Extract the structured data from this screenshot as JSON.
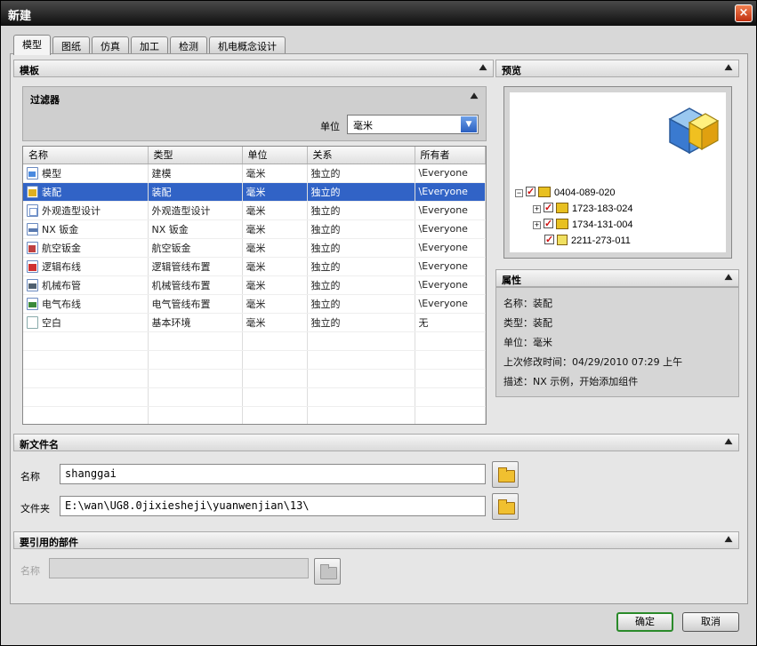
{
  "window": {
    "title": "新建",
    "close_label": "×"
  },
  "tabs": [
    {
      "label": "模型"
    },
    {
      "label": "图纸"
    },
    {
      "label": "仿真"
    },
    {
      "label": "加工"
    },
    {
      "label": "检测"
    },
    {
      "label": "机电概念设计"
    }
  ],
  "templates_section": {
    "title": "模板",
    "filter": {
      "title": "过滤器",
      "unit_label": "单位",
      "unit_value": "毫米"
    },
    "columns": [
      "名称",
      "类型",
      "单位",
      "关系",
      "所有者"
    ],
    "rows": [
      {
        "icon": "part-icon",
        "name": "模型",
        "type": "建模",
        "unit": "毫米",
        "relation": "独立的",
        "owner": "\\Everyone"
      },
      {
        "icon": "assembly-icon",
        "name": "装配",
        "type": "装配",
        "unit": "毫米",
        "relation": "独立的",
        "owner": "\\Everyone",
        "selected": true
      },
      {
        "icon": "shape-icon",
        "name": "外观造型设计",
        "type": "外观造型设计",
        "unit": "毫米",
        "relation": "独立的",
        "owner": "\\Everyone"
      },
      {
        "icon": "sheet-metal-icon",
        "name": "NX 钣金",
        "type": "NX 钣金",
        "unit": "毫米",
        "relation": "独立的",
        "owner": "\\Everyone"
      },
      {
        "icon": "aero-sheet-metal-icon",
        "name": "航空钣金",
        "type": "航空钣金",
        "unit": "毫米",
        "relation": "独立的",
        "owner": "\\Everyone"
      },
      {
        "icon": "logic-routing-icon",
        "name": "逻辑布线",
        "type": "逻辑管线布置",
        "unit": "毫米",
        "relation": "独立的",
        "owner": "\\Everyone"
      },
      {
        "icon": "mechanical-routing-icon",
        "name": "机械布管",
        "type": "机械管线布置",
        "unit": "毫米",
        "relation": "独立的",
        "owner": "\\Everyone"
      },
      {
        "icon": "electrical-routing-icon",
        "name": "电气布线",
        "type": "电气管线布置",
        "unit": "毫米",
        "relation": "独立的",
        "owner": "\\Everyone"
      },
      {
        "icon": "blank-icon",
        "name": "空白",
        "type": "基本环境",
        "unit": "毫米",
        "relation": "独立的",
        "owner": "无"
      }
    ]
  },
  "preview_section": {
    "title": "预览",
    "tree": [
      {
        "label": "0404-089-020"
      },
      {
        "label": "1723-183-024"
      },
      {
        "label": "1734-131-004"
      },
      {
        "label": "2211-273-011"
      }
    ]
  },
  "properties_section": {
    "title": "属性",
    "name": "名称：装配",
    "type": "类型：装配",
    "unit": "单位：毫米",
    "modified": "上次修改时间：04/29/2010 07:29 上午",
    "description": "描述：NX 示例，开始添加组件"
  },
  "new_filename_section": {
    "title": "新文件名",
    "name_label": "名称",
    "name_value": "shanggai",
    "folder_label": "文件夹",
    "folder_value": "E:\\wan\\UG8.0jixiesheji\\yuanwenjian\\13\\"
  },
  "referenced_part_section": {
    "title": "要引用的部件",
    "name_label": "名称",
    "name_value": ""
  },
  "buttons": {
    "ok": "确定",
    "cancel": "取消"
  }
}
